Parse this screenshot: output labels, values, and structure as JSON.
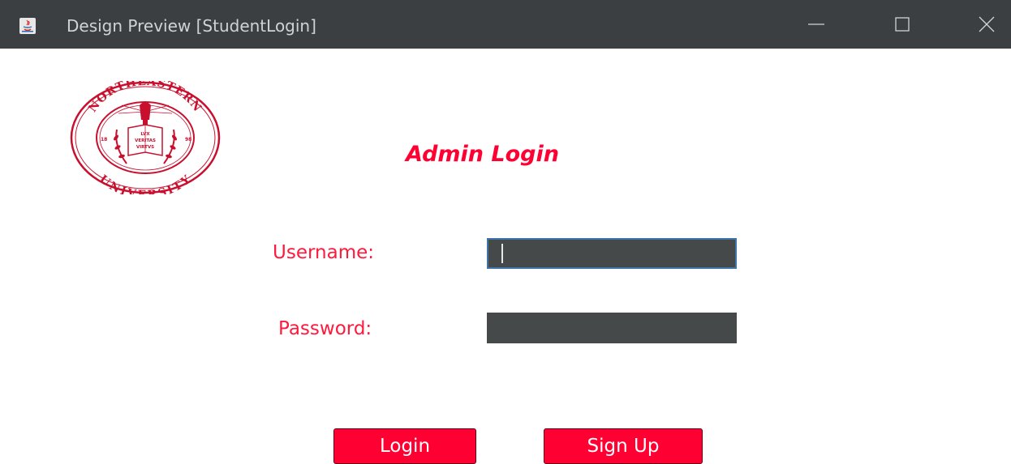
{
  "window": {
    "title": "Design Preview [StudentLogin]",
    "icon": "java-icon",
    "controls": [
      "minimize-icon",
      "maximize-icon",
      "close-icon"
    ]
  },
  "logo": {
    "name": "northeastern-university-seal",
    "top_text": "NORTHEASTERN",
    "bottom_text": "UNIVERSITY",
    "motto": [
      "LVX",
      "VERITAS",
      "VIRTVS"
    ],
    "year_left": "18",
    "year_right": "98"
  },
  "form": {
    "heading": "Admin Login",
    "username_label": "Username:",
    "username_value": "",
    "password_label": "Password:",
    "password_value": ""
  },
  "buttons": {
    "login": "Login",
    "signup": "Sign Up"
  },
  "colors": {
    "accent": "#ff0033",
    "titlebar": "#3c3f41",
    "field_bg": "#45494a",
    "focus_border": "#3f74a8"
  }
}
